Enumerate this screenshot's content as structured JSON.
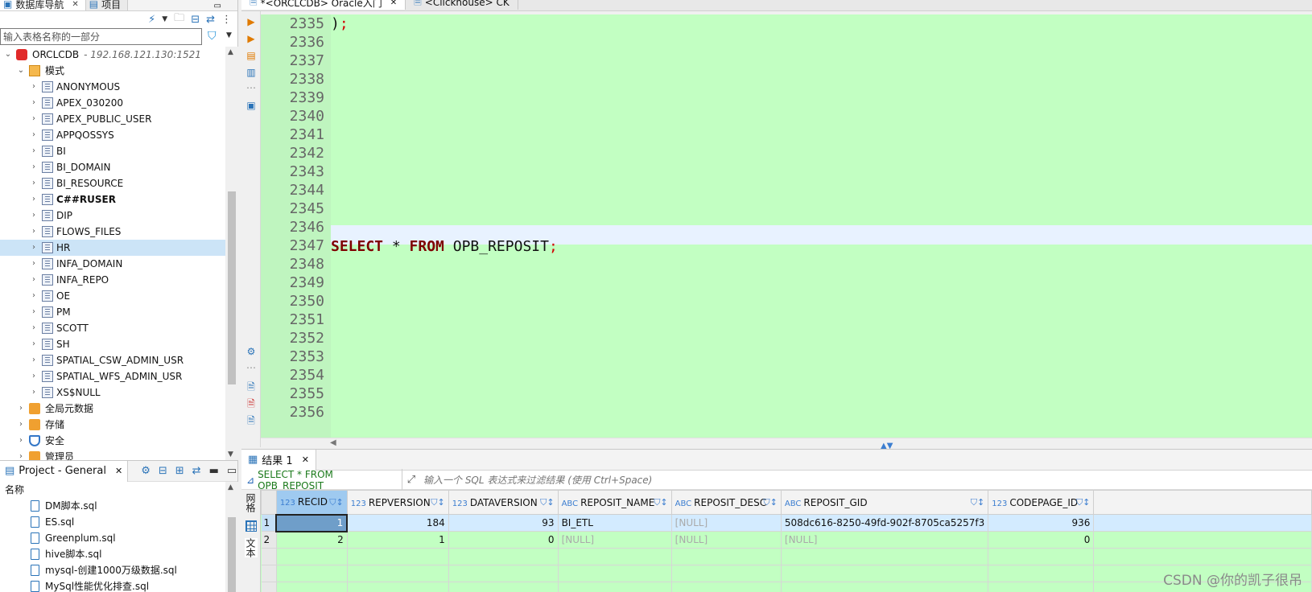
{
  "navigator": {
    "tabs": [
      {
        "label": "数据库导航",
        "active": true
      },
      {
        "label": "项目",
        "active": false
      }
    ],
    "filter_placeholder": "输入表格名称的一部分",
    "connection": {
      "name": "ORCLCDB",
      "host": "- 192.168.121.130:1521"
    },
    "schemas_folder": "模式",
    "schemas": [
      "ANONYMOUS",
      "APEX_030200",
      "APEX_PUBLIC_USER",
      "APPQOSSYS",
      "BI",
      "BI_DOMAIN",
      "BI_RESOURCE",
      "C##RUSER",
      "DIP",
      "FLOWS_FILES",
      "HR",
      "INFA_DOMAIN",
      "INFA_REPO",
      "OE",
      "PM",
      "SCOTT",
      "SH",
      "SPATIAL_CSW_ADMIN_USR",
      "SPATIAL_WFS_ADMIN_USR",
      "XS$NULL"
    ],
    "bold_schema": "C##RUSER",
    "selected_schema": "HR",
    "folders": [
      "全局元数据",
      "存储",
      "安全",
      "管理员"
    ]
  },
  "project": {
    "tab_label": "Project - General",
    "column_header": "名称",
    "files": [
      "DM脚本.sql",
      "ES.sql",
      "Greenplum.sql",
      "hive脚本.sql",
      "mysql-创建1000万级数据.sql",
      "MySql性能优化排查.sql"
    ]
  },
  "editor": {
    "tabs": [
      {
        "label": "*<ORCLCDB> Oracle入门",
        "active": true
      },
      {
        "label": "<Clickhouse> CK",
        "active": false
      }
    ],
    "first_line_number": 2335,
    "line_numbers": [
      "2335",
      "2336",
      "2337",
      "2338",
      "2339",
      "2340",
      "2341",
      "2342",
      "2343",
      "2344",
      "2345",
      "2346",
      "2347",
      "2348",
      "2349",
      "2350",
      "2351",
      "2352",
      "2353",
      "2354",
      "2355",
      "2356"
    ],
    "line_2335_text": ")",
    "line_2335_punc": ";",
    "sql_keyword_select": "SELECT",
    "sql_star": " * ",
    "sql_keyword_from": "FROM",
    "sql_table": " OPB_REPOSIT",
    "sql_semicolon": ";"
  },
  "results": {
    "tab_label": "结果 1",
    "query_text": "SELECT * FROM OPB_REPOSIT",
    "filter_placeholder": "输入一个 SQL 表达式来过滤结果 (使用 Ctrl+Space)",
    "vertical_tabs": [
      "网格",
      "文本"
    ],
    "columns": [
      {
        "type": "123",
        "name": "RECID"
      },
      {
        "type": "123",
        "name": "REPVERSION"
      },
      {
        "type": "123",
        "name": "DATAVERSION"
      },
      {
        "type": "ABC",
        "name": "REPOSIT_NAME"
      },
      {
        "type": "ABC",
        "name": "REPOSIT_DESC"
      },
      {
        "type": "ABC",
        "name": "REPOSIT_GID"
      },
      {
        "type": "123",
        "name": "CODEPAGE_ID"
      }
    ],
    "rows": [
      {
        "n": "1",
        "cells": [
          "1",
          "184",
          "93",
          "BI_ETL",
          "[NULL]",
          "508dc616-8250-49fd-902f-8705ca5257f3",
          "936"
        ]
      },
      {
        "n": "2",
        "cells": [
          "2",
          "1",
          "0",
          "[NULL]",
          "[NULL]",
          "[NULL]",
          "0"
        ]
      }
    ]
  },
  "watermark": "CSDN @你的凯子很吊"
}
